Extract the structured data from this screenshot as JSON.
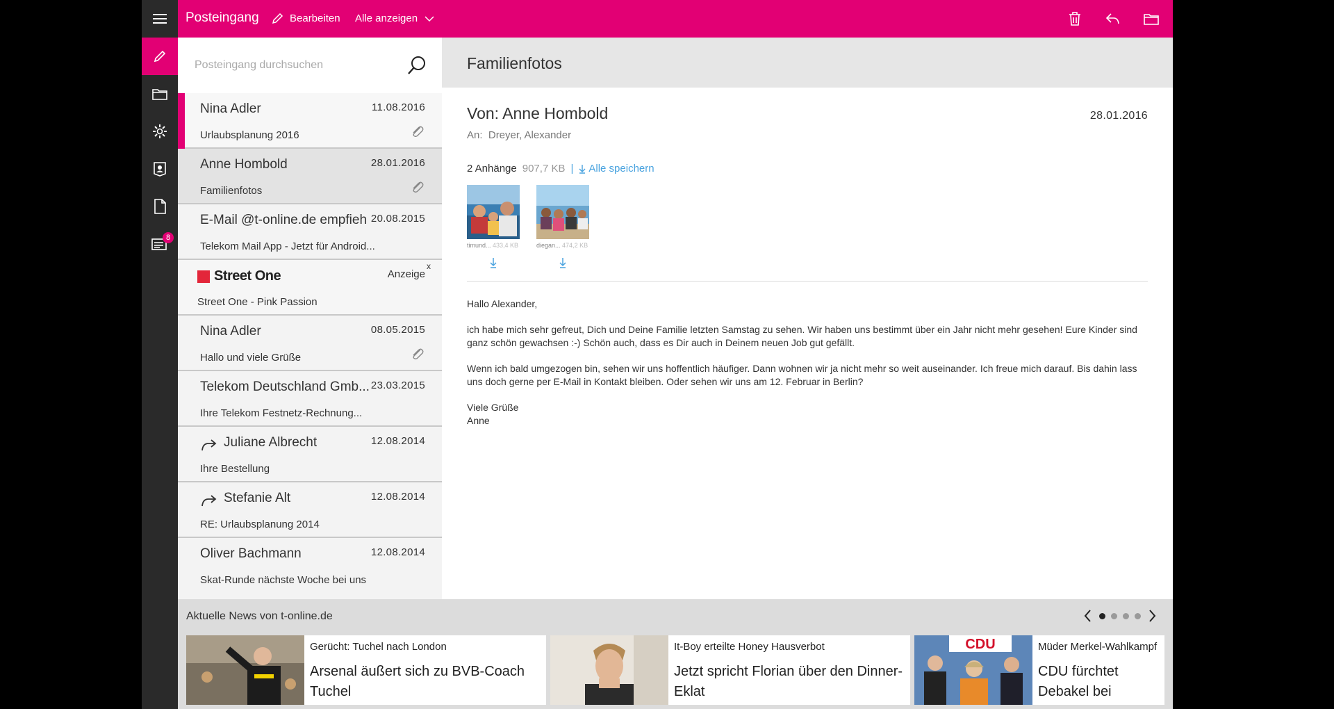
{
  "colors": {
    "magenta": "#e20074",
    "rail": "#2a2a2a",
    "link": "#4aa3df"
  },
  "topbar": {
    "title": "Posteingang",
    "edit_label": "Bearbeiten",
    "filter_label": "Alle anzeigen",
    "icons": [
      "trash-icon",
      "reply-icon",
      "folder-icon"
    ]
  },
  "rail": {
    "icons": [
      "pencil-icon",
      "folder-icon",
      "gear-icon",
      "contact-icon",
      "document-icon",
      "news-icon"
    ],
    "news_badge": "8"
  },
  "search": {
    "placeholder": "Posteingang durchsuchen"
  },
  "mails": [
    {
      "sender": "Nina Adler",
      "date": "11.08.2016",
      "subject": "Urlaubsplanung 2016",
      "attachment": true,
      "unread": true
    },
    {
      "sender": "Anne Hombold",
      "date": "28.01.2016",
      "subject": "Familienfotos",
      "attachment": true,
      "selected": true
    },
    {
      "sender": "E-Mail @t-online.de empfiehlt",
      "date": "20.08.2015",
      "subject": "Telekom Mail App - Jetzt für Android..."
    },
    {
      "ad": true,
      "brand": "Street One",
      "ad_label": "Anzeige",
      "ad_close": "x",
      "subject": "Street One - Pink Passion"
    },
    {
      "sender": "Nina Adler",
      "date": "08.05.2015",
      "subject": "Hallo und viele Grüße",
      "attachment": true
    },
    {
      "sender": "Telekom Deutschland Gmb...",
      "date": "23.03.2015",
      "subject": "Ihre Telekom Festnetz-Rechnung..."
    },
    {
      "sender": "Juliane Albrecht",
      "date": "12.08.2014",
      "subject": "Ihre Bestellung",
      "forwarded": true
    },
    {
      "sender": "Stefanie Alt",
      "date": "12.08.2014",
      "subject": "RE: Urlaubsplanung 2014",
      "forwarded": true
    },
    {
      "sender": "Oliver Bachmann",
      "date": "12.08.2014",
      "subject": "Skat-Runde nächste Woche bei uns"
    }
  ],
  "reader": {
    "subject": "Familienfotos",
    "from": "Von: Anne Hombold",
    "date": "28.01.2016",
    "to_label": "An:",
    "to": "Dreyer, Alexander",
    "attachments_count": "2 Anhänge",
    "attachments_size": "907,7 KB",
    "separator": "|",
    "save_all": "Alle speichern",
    "attachments": [
      {
        "name": "timund...",
        "size": "433,4 KB"
      },
      {
        "name": "diegan...",
        "size": "474,2 KB"
      }
    ],
    "body": {
      "greeting": "Hallo Alexander,",
      "p1": "ich habe mich sehr gefreut, Dich und Deine Familie letzten Samstag zu sehen. Wir haben uns bestimmt über ein Jahr nicht mehr gesehen! Eure Kinder sind ganz schön gewachsen :-) Schön auch, dass es Dir auch in Deinem neuen Job gut gefällt.",
      "p2": "Wenn ich bald umgezogen bin, sehen wir uns hoffentlich häufiger. Dann wohnen wir ja nicht mehr so weit auseinander. Ich freue mich darauf. Bis dahin lass uns doch gerne per E-Mail in Kontakt bleiben. Oder sehen wir uns am 12. Februar in Berlin?",
      "closing": "Viele Grüße",
      "name": "Anne"
    }
  },
  "news": {
    "heading": "Aktuelle News von t-online.de",
    "pages": 4,
    "active_page": 1,
    "cards": [
      {
        "kicker": "Gerücht: Tuchel nach London",
        "headline": "Arsenal äußert sich zu BVB-Coach Tuchel"
      },
      {
        "kicker": "It-Boy erteilte Honey Hausverbot",
        "headline": "Jetzt spricht Florian über den Dinner-Eklat"
      },
      {
        "kicker": "Müder Merkel-Wahlkampf",
        "headline": "CDU fürchtet Debakel bei Landtagswahlen",
        "image_text": "CDU"
      }
    ]
  }
}
